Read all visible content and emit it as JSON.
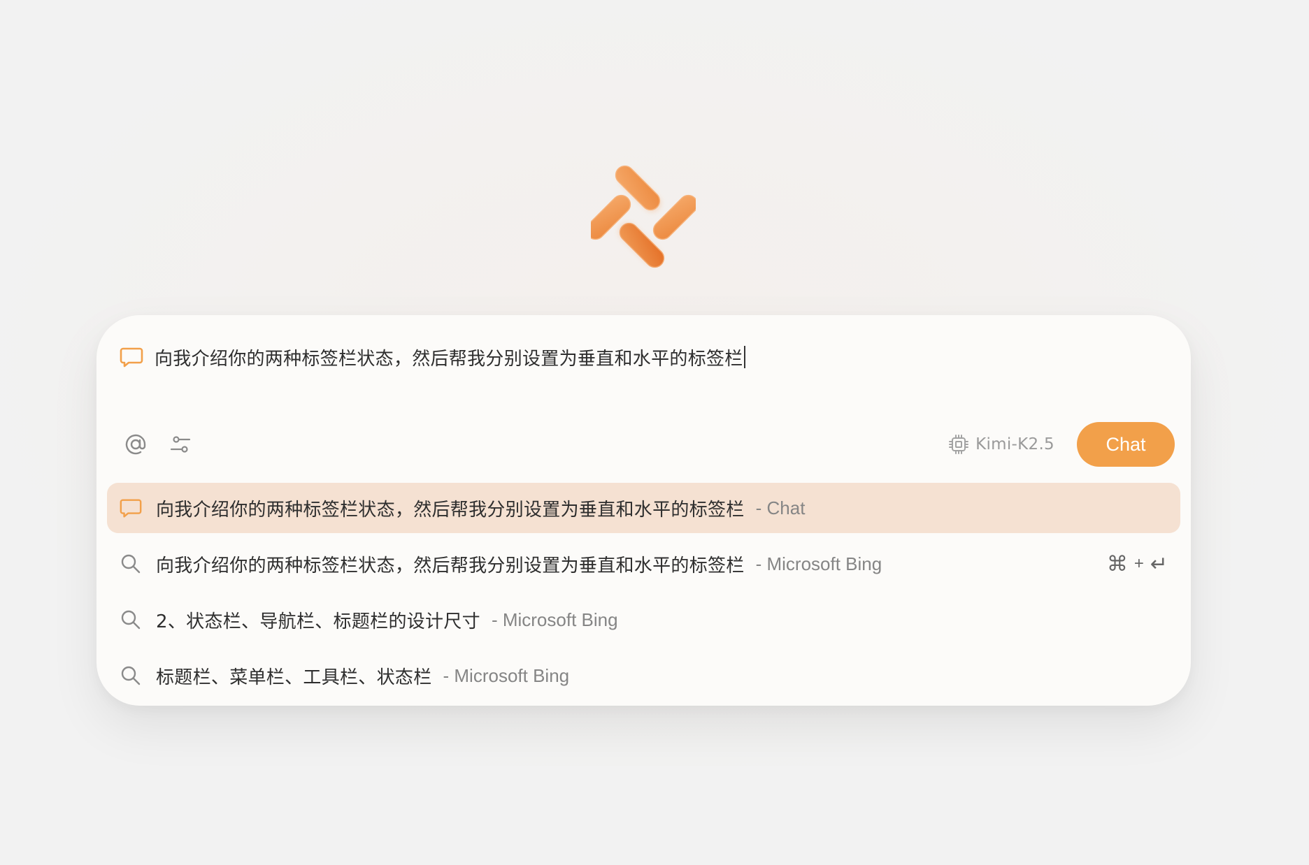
{
  "prompt": {
    "text": "向我介绍你的两种标签栏状态，然后帮我分别设置为垂直和水平的标签栏",
    "icon": "chat-bubble-icon"
  },
  "toolbar": {
    "mention_icon": "at-icon",
    "settings_icon": "sliders-icon",
    "model_icon": "chip-icon",
    "model_label": "Kimi-K2.5",
    "chat_button_label": "Chat"
  },
  "suggestions": [
    {
      "icon": "chat-bubble-icon",
      "text": "向我介绍你的两种标签栏状态，然后帮我分别设置为垂直和水平的标签栏",
      "source": "- Chat",
      "active": true
    },
    {
      "icon": "search-icon",
      "text": "向我介绍你的两种标签栏状态，然后帮我分别设置为垂直和水平的标签栏",
      "source": "- Microsoft Bing",
      "shortcut": {
        "key": "⌘",
        "plus": "+",
        "enter": "↵"
      }
    },
    {
      "icon": "search-icon",
      "text": "2、状态栏、导航栏、标题栏的设计尺寸",
      "source": "- Microsoft Bing"
    },
    {
      "icon": "search-icon",
      "text": "标题栏、菜单栏、工具栏、状态栏",
      "source": "- Microsoft Bing"
    }
  ],
  "colors": {
    "accent": "#f2a04a",
    "highlight": "#f5e1d2",
    "panel": "#fcfbf9"
  }
}
